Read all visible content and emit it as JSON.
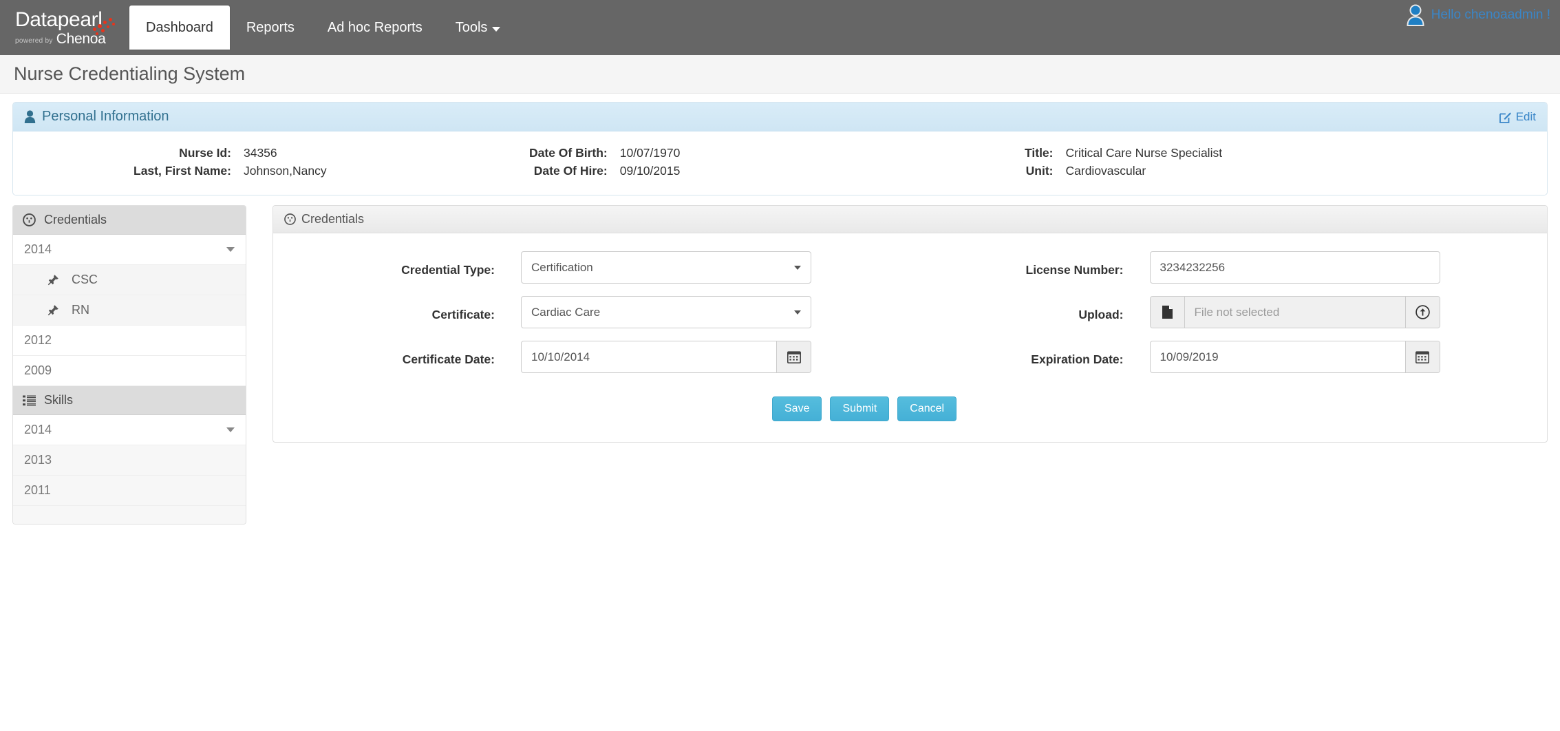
{
  "navbar": {
    "brand": {
      "line1": "Datapearl",
      "powered": "powered by",
      "company": "Chenoa"
    },
    "items": [
      {
        "label": "Dashboard",
        "active": true,
        "caret": false
      },
      {
        "label": "Reports",
        "active": false,
        "caret": false
      },
      {
        "label": "Ad hoc Reports",
        "active": false,
        "caret": false
      },
      {
        "label": "Tools",
        "active": false,
        "caret": true
      }
    ],
    "user": {
      "greeting": "Hello chenoaadmin !",
      "avatar_icon": "user-avatar-icon"
    },
    "background": "#666666",
    "link_color": "#3a86c8"
  },
  "page": {
    "title": "Nurse Credentialing System"
  },
  "personal_information": {
    "header": "Personal Information",
    "header_icon": "person-icon",
    "edit_label": "Edit",
    "edit_icon": "edit-pencil-icon",
    "columns": [
      {
        "fields": [
          {
            "label": "Nurse Id:",
            "value": "34356"
          },
          {
            "label": "Last, First Name:",
            "value": "Johnson,Nancy"
          }
        ]
      },
      {
        "fields": [
          {
            "label": "Date Of Birth:",
            "value": "10/07/1970"
          },
          {
            "label": "Date Of Hire:",
            "value": "09/10/2015"
          }
        ]
      },
      {
        "fields": [
          {
            "label": "Title:",
            "value": "Critical Care Nurse Specialist"
          },
          {
            "label": "Unit:",
            "value": "Cardiovascular"
          }
        ]
      }
    ]
  },
  "sidebar": {
    "groups": [
      {
        "title": "Credentials",
        "icon": "clock-icon",
        "items": [
          {
            "label": "2014",
            "expandable": true,
            "child": false
          },
          {
            "label": "CSC",
            "expandable": false,
            "child": true,
            "icon": "pin-icon"
          },
          {
            "label": "RN",
            "expandable": false,
            "child": true,
            "icon": "pin-icon"
          },
          {
            "label": "2012",
            "expandable": false,
            "child": false
          },
          {
            "label": "2009",
            "expandable": false,
            "child": false
          }
        ]
      },
      {
        "title": "Skills",
        "icon": "list-icon",
        "items": [
          {
            "label": "2014",
            "expandable": true,
            "child": false
          },
          {
            "label": "2013",
            "expandable": false,
            "child": false
          },
          {
            "label": "2011",
            "expandable": false,
            "child": false
          }
        ]
      }
    ]
  },
  "credentials_form": {
    "header": "Credentials",
    "header_icon": "clock-icon",
    "left_fields": [
      {
        "label": "Credential Type:",
        "type": "select",
        "value": "Certification",
        "name": "credential-type"
      },
      {
        "label": "Certificate:",
        "type": "select",
        "value": "Cardiac Care",
        "name": "certificate"
      },
      {
        "label": "Certificate Date:",
        "type": "date",
        "value": "10/10/2014",
        "name": "certificate-date",
        "addon_icon": "calendar-icon"
      }
    ],
    "right_fields": [
      {
        "label": "License Number:",
        "type": "text",
        "value": "3234232256",
        "name": "license-number"
      },
      {
        "label": "Upload:",
        "type": "file",
        "value": "File not selected",
        "name": "upload",
        "left_icon": "file-icon",
        "addon_icon": "upload-arrow-icon"
      },
      {
        "label": "Expiration Date:",
        "type": "date",
        "value": "10/09/2019",
        "name": "expiration-date",
        "addon_icon": "calendar-icon"
      }
    ],
    "buttons": [
      {
        "label": "Save",
        "name": "save-button"
      },
      {
        "label": "Submit",
        "name": "submit-button"
      },
      {
        "label": "Cancel",
        "name": "cancel-button"
      }
    ],
    "button_color": "#4cb6d9"
  }
}
